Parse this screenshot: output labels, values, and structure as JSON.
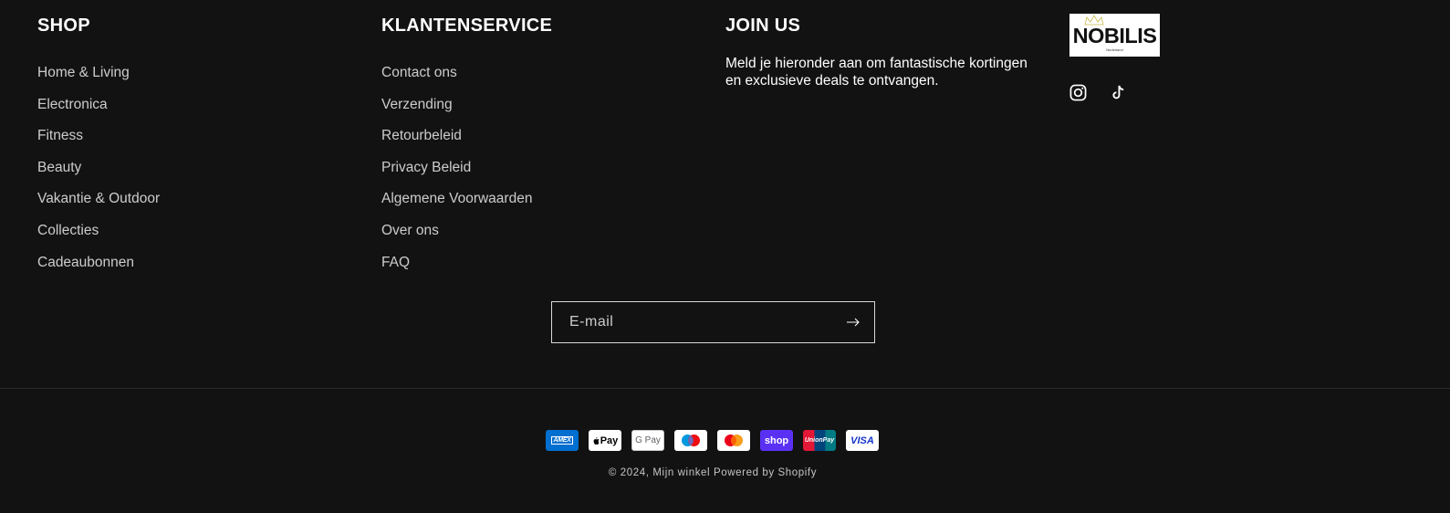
{
  "footer": {
    "shop": {
      "heading": "SHOP",
      "links": [
        "Home & Living",
        "Electronica",
        "Fitness",
        "Beauty",
        "Vakantie & Outdoor",
        "Collecties",
        "Cadeaubonnen"
      ]
    },
    "service": {
      "heading": "KLANTENSERVICE",
      "links": [
        "Contact ons",
        "Verzending",
        "Retourbeleid",
        "Privacy Beleid",
        "Algemene Voorwaarden",
        "Over ons",
        "FAQ"
      ]
    },
    "join": {
      "heading": "JOIN US",
      "text": "Meld je hieronder aan om fantastische kortingen en exclusieve deals te ontvangen."
    },
    "brand": {
      "logo_text": "NOBILIS",
      "logo_subtext": "Nederland",
      "social_icons": [
        "instagram-icon",
        "tiktok-icon"
      ]
    }
  },
  "newsletter": {
    "placeholder": "E-mail",
    "submit_icon": "arrow-right-icon"
  },
  "payments": {
    "methods": [
      {
        "name": "American Express",
        "label": "AMEX"
      },
      {
        "name": "Apple Pay",
        "label": "Pay"
      },
      {
        "name": "Google Pay",
        "label": "G Pay"
      },
      {
        "name": "Maestro",
        "label": ""
      },
      {
        "name": "Mastercard",
        "label": ""
      },
      {
        "name": "Shop Pay",
        "label": "shop"
      },
      {
        "name": "UnionPay",
        "label": "UnionPay"
      },
      {
        "name": "Visa",
        "label": "VISA"
      }
    ]
  },
  "copyright": {
    "prefix": "© 2024, ",
    "store_name": "Mijn winkel",
    "powered_by": "Powered by Shopify"
  },
  "colors": {
    "background": "#121212",
    "text": "#ffffff"
  }
}
